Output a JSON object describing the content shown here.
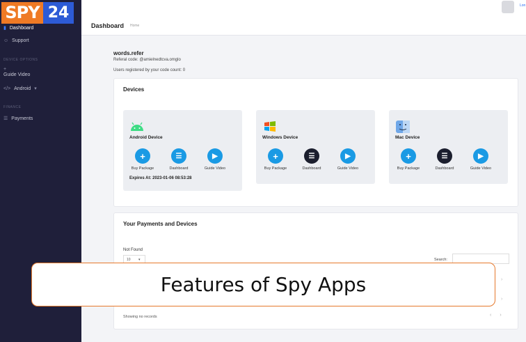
{
  "logo": {
    "left": "SPY",
    "right": "24"
  },
  "sidebar": {
    "items": [
      {
        "label": "Dashboard",
        "icon": "dashboard-icon"
      },
      {
        "label": "Support",
        "icon": "support-icon"
      }
    ],
    "sections": [
      {
        "label": "DEVICE OPTIONS",
        "items": [
          {
            "label": "Guide Video",
            "icon": "plus-icon"
          },
          {
            "label": "Android",
            "icon": "code-icon"
          }
        ]
      },
      {
        "label": "FINANCE",
        "items": [
          {
            "label": "Payments",
            "icon": "list-icon"
          }
        ]
      }
    ]
  },
  "topbar": {
    "user": "Lon"
  },
  "header": {
    "title": "Dashboard",
    "breadcrumb": "Home"
  },
  "user": {
    "name": "words.refer",
    "referral": "Referal code: @amielnedtcva.omglo",
    "count": "Users registered by your code count: 0"
  },
  "devices": {
    "title": "Devices",
    "cards": [
      {
        "name": "Android Device",
        "icon": "android-icon",
        "expires": "Expires At: 2023-01-06 08:53:28"
      },
      {
        "name": "Windows Device",
        "icon": "windows-icon",
        "expires": ""
      },
      {
        "name": "Mac Device",
        "icon": "finder-icon",
        "expires": ""
      }
    ],
    "actions": {
      "buy": "Buy Package",
      "dash": "Dashboard",
      "guide": "Guide Video"
    }
  },
  "payments": {
    "title": "Your Payments and Devices",
    "not_found": "Not Found",
    "page_size": "10",
    "search_label": "Search:",
    "showing": "Showing no records"
  },
  "banner": {
    "text": "Features of Spy Apps"
  },
  "colors": {
    "sidebar": "#1f1f3a",
    "accent_orange": "#ef7a25",
    "accent_blue": "#2d5bd6",
    "action_blue": "#1a9ae4"
  }
}
